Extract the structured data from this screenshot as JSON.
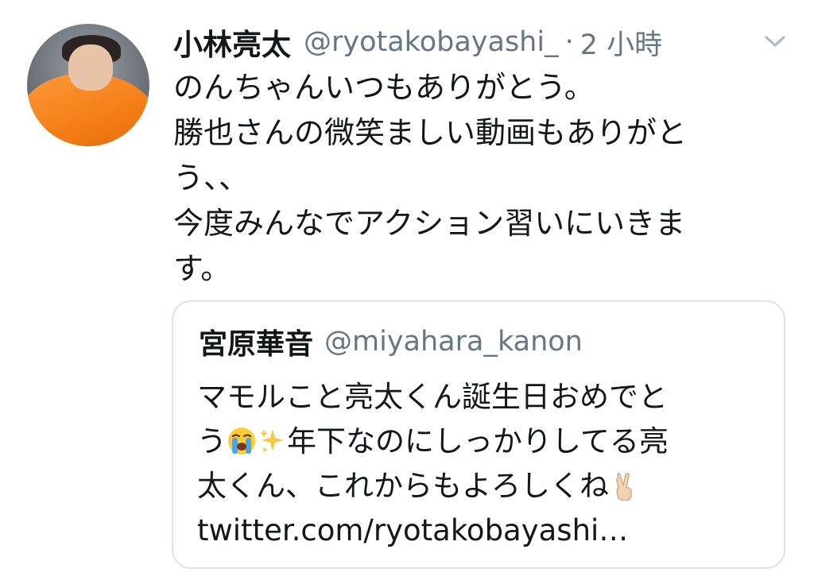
{
  "tweet": {
    "display_name": "小林亮太",
    "handle": "@ryotakobayashi_",
    "separator": "·",
    "time": "2 小時",
    "text_lines": [
      "のんちゃんいつもありがとう。",
      "勝也さんの微笑ましい動画もありがと",
      "う、、",
      "今度みんなでアクション習いにいきま",
      "す。"
    ],
    "menu_icon": "chevron-down-icon"
  },
  "quote": {
    "display_name": "宮原華音",
    "handle": "@miyahara_kanon",
    "line1": "マモルこと亮太くん誕生日おめでと",
    "line2_a": "う",
    "line2_b": "年下なのにしっかりしてる亮",
    "line3": "太くん、これからもよろしくね",
    "link": "twitter.com/ryotakobayashi…",
    "emojis": [
      "loudly-crying-face-emoji",
      "sparkles-emoji",
      "victory-hand-emoji"
    ]
  },
  "colors": {
    "text": "#14171a",
    "secondary": "#657786",
    "border": "#dde3e8"
  }
}
